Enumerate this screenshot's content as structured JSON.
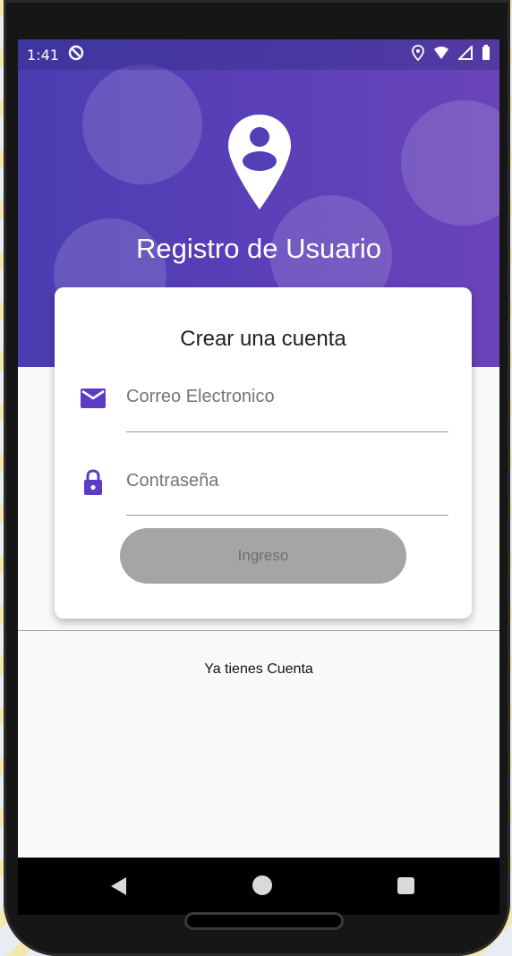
{
  "status_bar": {
    "time": "1:41"
  },
  "header": {
    "title": "Registro de Usuario"
  },
  "form": {
    "title": "Crear una cuenta",
    "email_placeholder": "Correo Electronico",
    "password_placeholder": "Contraseña",
    "submit_label": "Ingreso"
  },
  "footer": {
    "link_text": "Ya tienes Cuenta"
  },
  "colors": {
    "accent": "#5b3cc4",
    "button_disabled": "#a5a5a5"
  },
  "icons": {
    "email": "mail-icon",
    "password": "lock-icon",
    "header": "user-location-pin-icon"
  }
}
